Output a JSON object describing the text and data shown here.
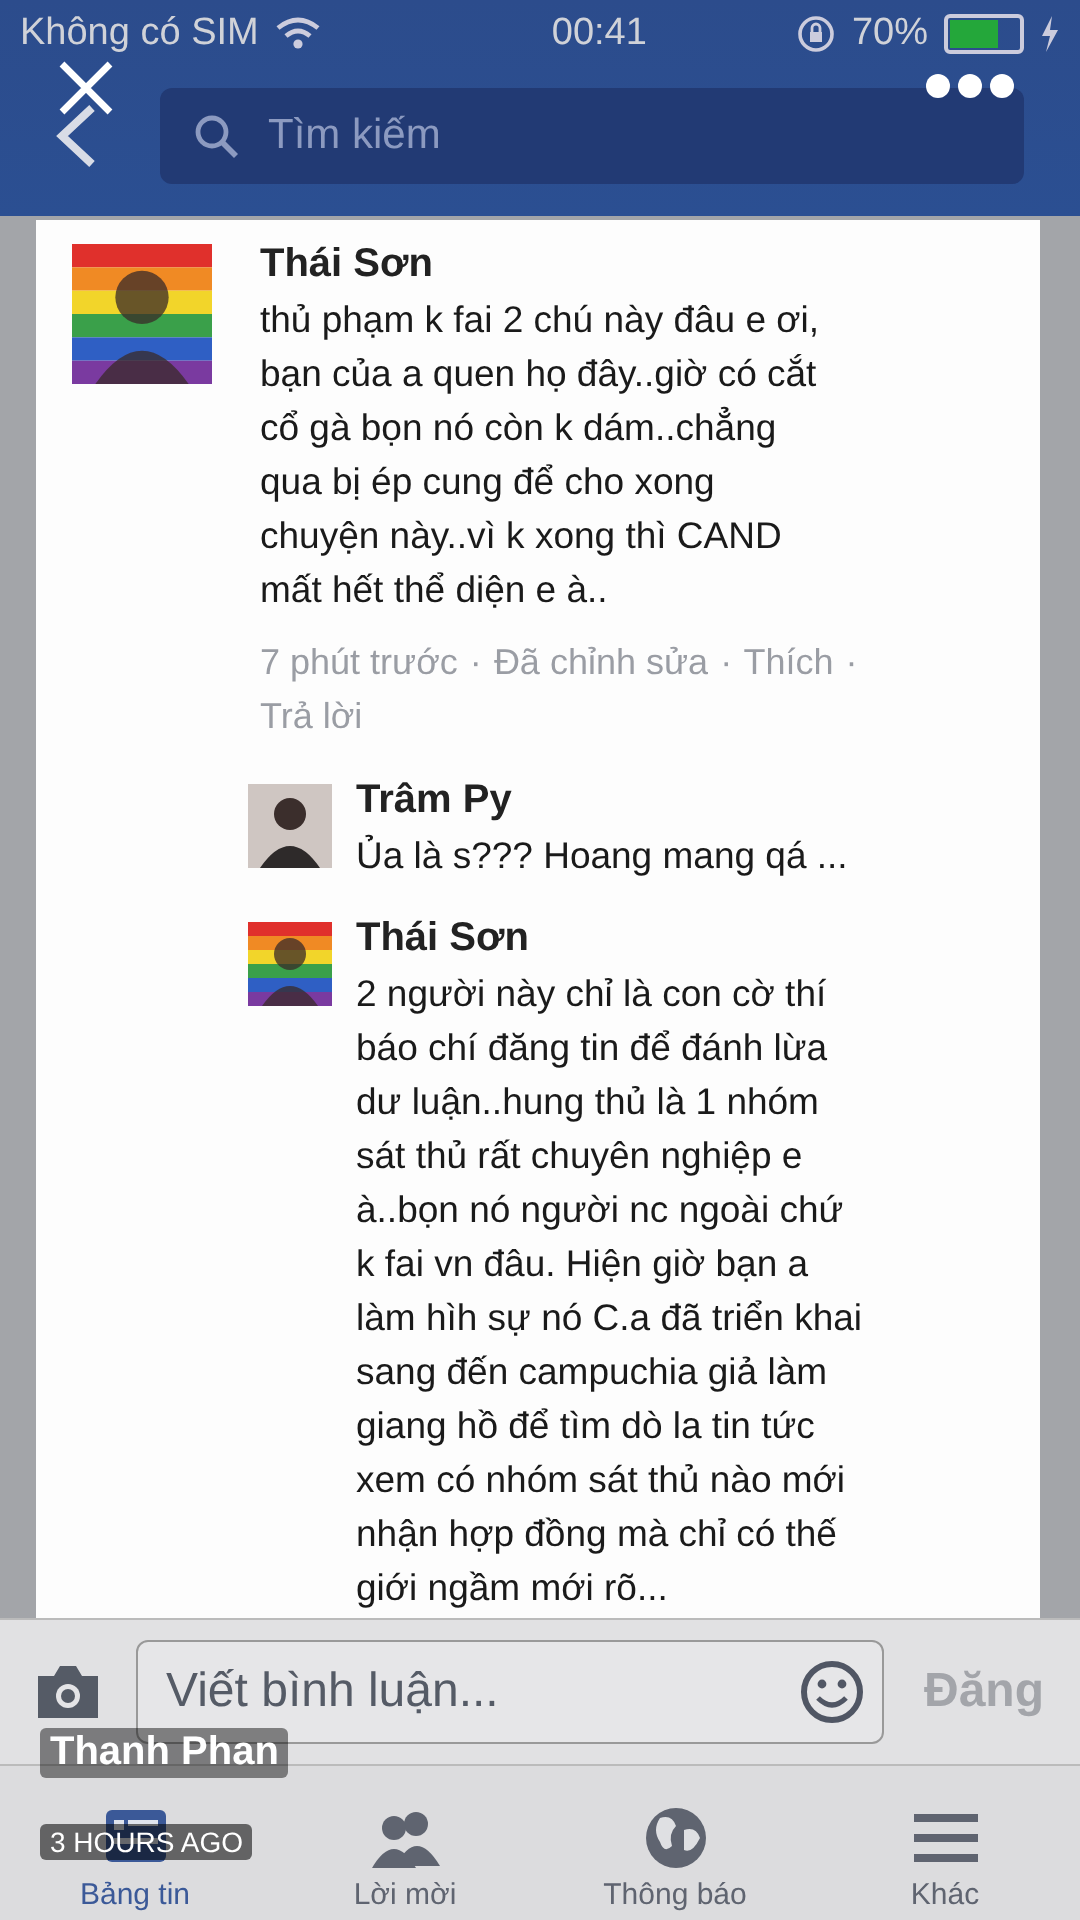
{
  "status_bar": {
    "carrier": "Không có SIM",
    "time": "00:41",
    "battery": "70%"
  },
  "search": {
    "placeholder": "Tìm kiếm"
  },
  "comments": [
    {
      "author": "Thái Sơn",
      "avatar": {
        "kind": "rainbow"
      },
      "text": "thủ phạm k fai 2 chú này đâu e ơi,\nbạn của a quen họ đây..giờ có cắt\ncổ gà bọn nó còn k dám..chẳng\nqua bị ép cung để cho xong\nchuyện này..vì k xong thì CAND\nmất hết thể diện e à..",
      "meta": [
        "7 phút trước",
        "·",
        "Đã chỉnh sửa",
        "·",
        "Thích",
        "·",
        "Trả lời"
      ],
      "replies": [
        {
          "author": "Trâm Py",
          "avatar": {
            "kind": "photo"
          },
          "text": "Ủa là s??? Hoang mang qá ..."
        },
        {
          "author": "Thái Sơn",
          "avatar": {
            "kind": "rainbow"
          },
          "text": "2 người này chỉ là con cờ thí\nbáo chí đăng tin để đánh lừa\ndư luận..hung thủ là 1 nhóm\nsát thủ rất chuyên nghiệp e\nà..bọn nó người nc ngoài chứ\nk fai vn đâu. Hiện giờ bạn a\nlàm hìh sự nó C.a đã triển khai\nsang đến campuchia giả làm\ngiang hồ để tìm dò la tin tức\nxem có nhóm sát thủ nào mới\nnhận hợp đồng mà chỉ có thế\ngiới ngầm mới rõ..."
        }
      ]
    }
  ],
  "composer": {
    "placeholder": "Viết bình luận...",
    "post": "Đăng"
  },
  "tabs": [
    {
      "label": "Bảng tin",
      "kind": "feed",
      "selected": true
    },
    {
      "label": "Lời mời",
      "kind": "friends",
      "selected": false
    },
    {
      "label": "Thông báo",
      "kind": "globe",
      "selected": false
    },
    {
      "label": "Khác",
      "kind": "menu",
      "selected": false
    }
  ],
  "viewer": {
    "author": "Thanh Phan",
    "time": "3 HOURS AGO"
  }
}
